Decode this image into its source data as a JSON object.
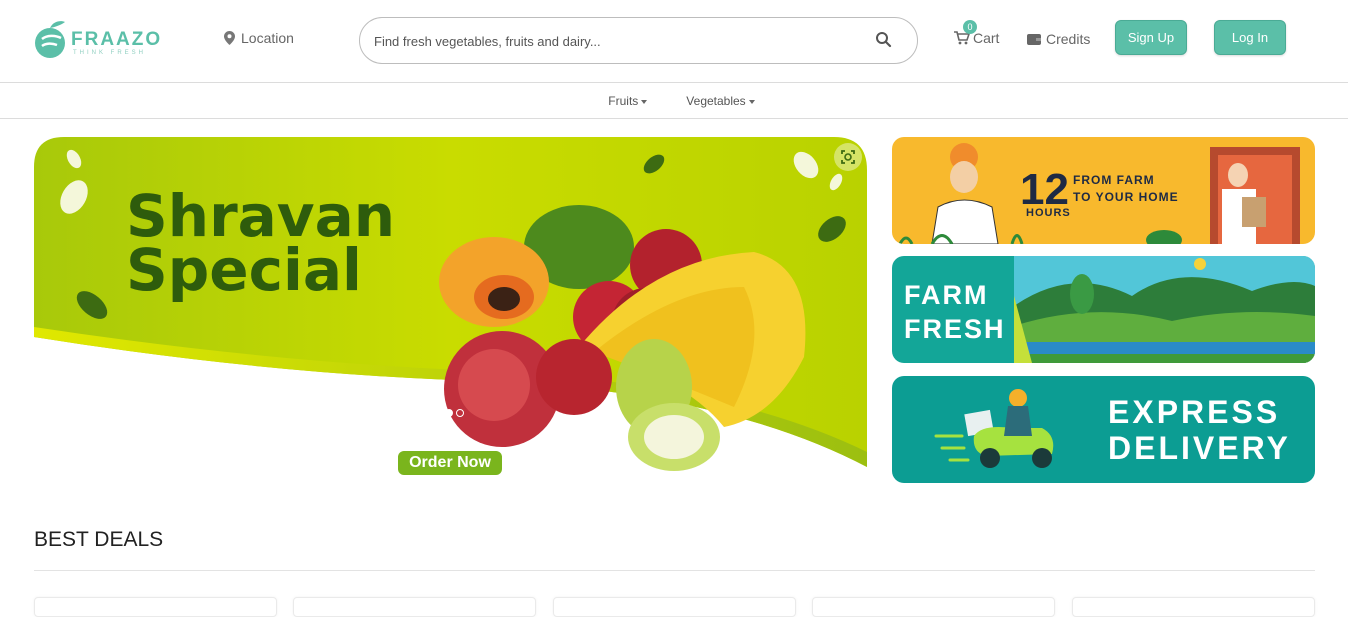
{
  "header": {
    "logo_text": "FRAAZO",
    "logo_tagline": "THINK FRESH",
    "location_label": "Location",
    "search_placeholder": "Find fresh vegetables, fruits and dairy...",
    "cart_label": "Cart",
    "cart_count": "0",
    "credits_label": "Credits",
    "signup_label": "Sign Up",
    "login_label": "Log In"
  },
  "nav": {
    "items": [
      {
        "label": "Fruits"
      },
      {
        "label": "Vegetables"
      }
    ]
  },
  "hero": {
    "title_line1": "Shravan",
    "title_line2": "Special",
    "cta_label": "Order Now",
    "slide_count": 2,
    "active_slide": 1
  },
  "banners": [
    {
      "number": "12",
      "line1": "FROM FARM",
      "line2": "TO YOUR HOME",
      "line3": "HOURS"
    },
    {
      "line1": "FARM",
      "line2": "FRESH"
    },
    {
      "line1": "EXPRESS",
      "line2": "DELIVERY"
    }
  ],
  "best_deals": {
    "title": "BEST DEALS"
  },
  "colors": {
    "brand": "#5bbfa8",
    "hero_green": "#c6d800",
    "hero_text": "#2e5c0c",
    "banner_yellow": "#f8b92d",
    "banner_teal": "#13a698"
  }
}
